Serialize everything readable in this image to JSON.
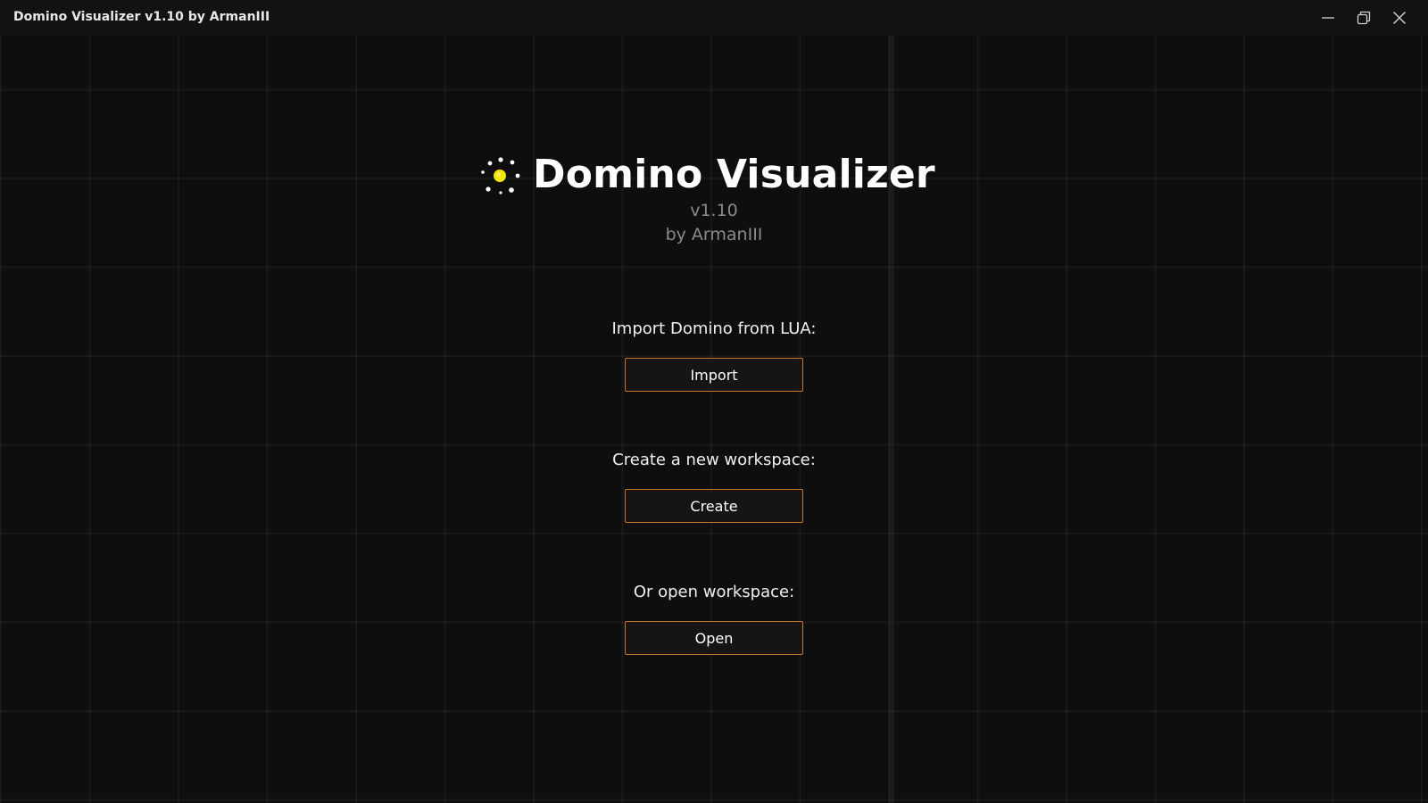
{
  "window": {
    "title": "Domino Visualizer v1.10 by ArmanIII",
    "controls": [
      "minimize-icon",
      "maximize-icon",
      "close-icon"
    ]
  },
  "hero": {
    "icon": "sun-dots-icon",
    "title": "Domino Visualizer",
    "version": "v1.10",
    "author": "by ArmanIII"
  },
  "sections": {
    "import": {
      "label": "Import Domino from LUA:",
      "button": "Import"
    },
    "create": {
      "label": "Create a new workspace:",
      "button": "Create"
    },
    "open": {
      "label": "Or open workspace:",
      "button": "Open"
    }
  },
  "colors": {
    "background": "#0e0e0e",
    "button_border": "#c97a2c",
    "logo_accent": "#f2e600",
    "muted_text": "#8a8a8a"
  }
}
